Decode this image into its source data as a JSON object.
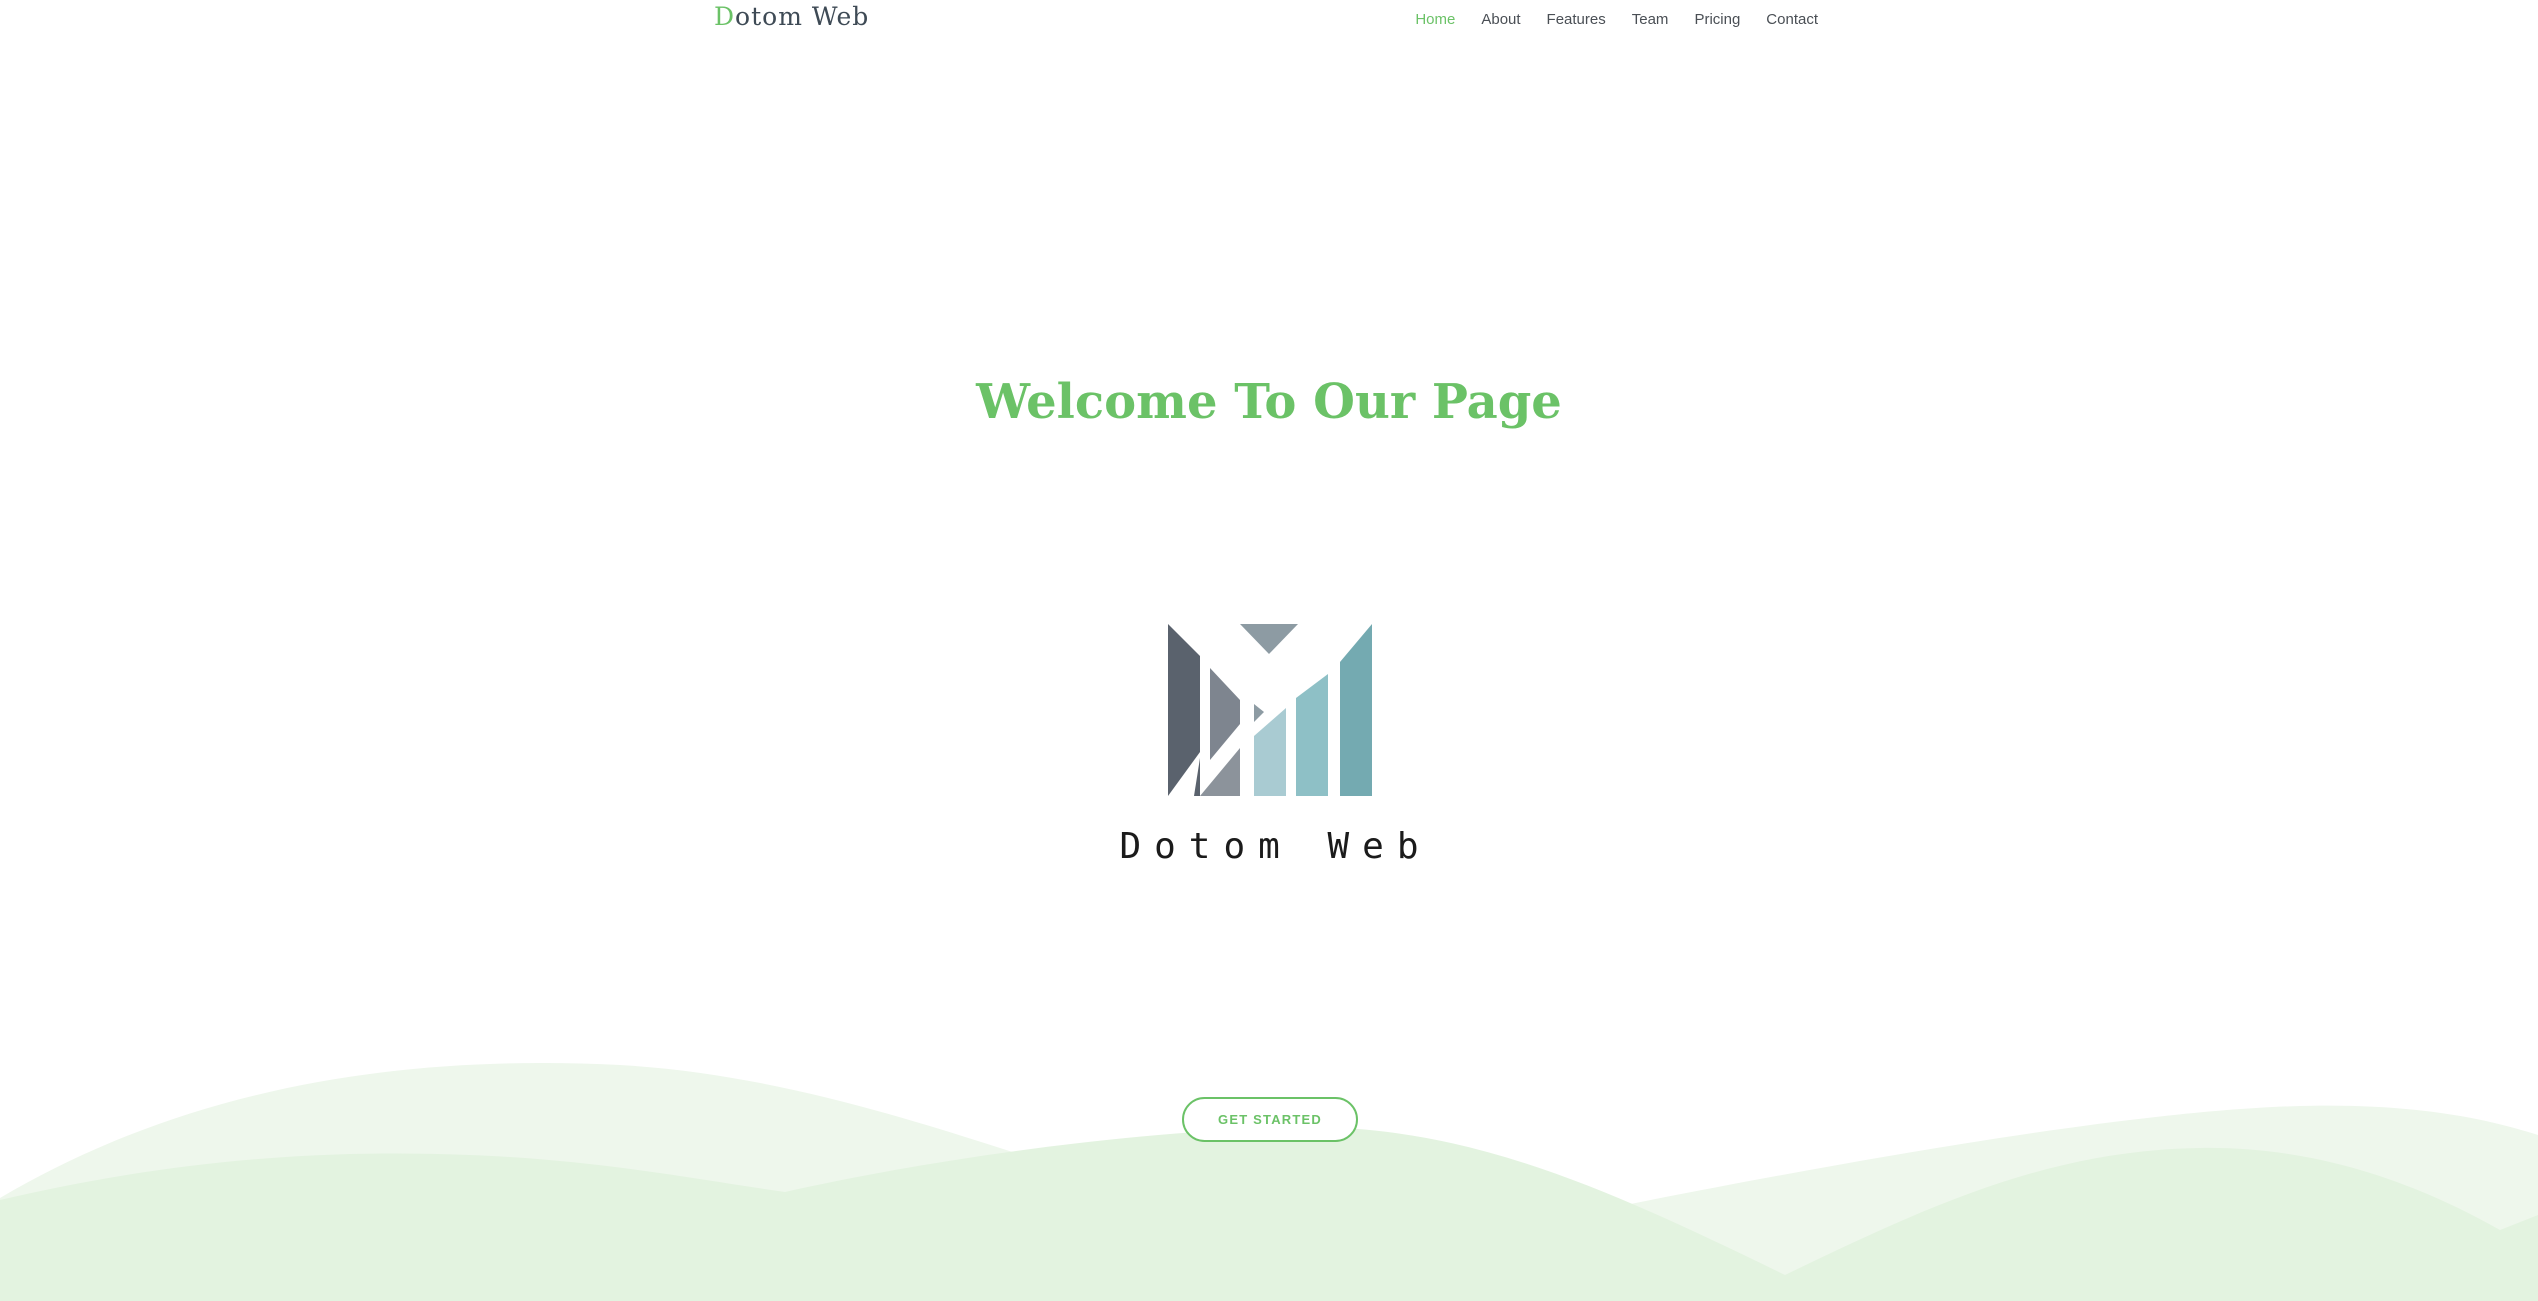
{
  "header": {
    "brand_first_letter": "D",
    "brand_rest": "otom Web",
    "nav": [
      {
        "label": "Home",
        "active": true
      },
      {
        "label": "About",
        "active": false
      },
      {
        "label": "Features",
        "active": false
      },
      {
        "label": "Team",
        "active": false
      },
      {
        "label": "Pricing",
        "active": false
      },
      {
        "label": "Contact",
        "active": false
      }
    ]
  },
  "hero": {
    "title": "Welcome To Our Page",
    "logo_text": "Dotom Web",
    "cta_label": "GET STARTED"
  },
  "colors": {
    "accent": "#6bc267",
    "nav_text": "#4a4f55",
    "wave_light": "#eef7ec",
    "wave_main": "#e3f3e0"
  },
  "icons": {
    "logo": "dotom-web-logo-icon"
  }
}
